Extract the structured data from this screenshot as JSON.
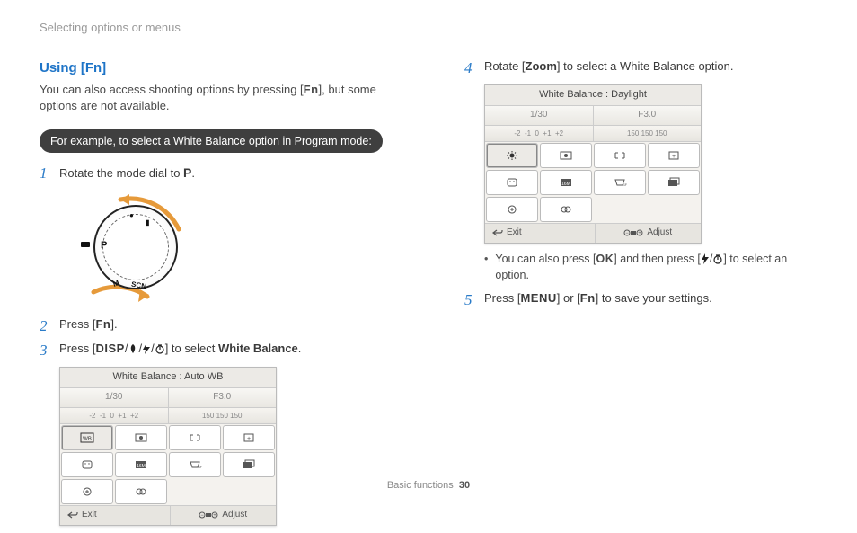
{
  "header": {
    "breadcrumb": "Selecting options or menus"
  },
  "section": {
    "title": "Using [Fn]",
    "intro_a": "You can also access shooting options by pressing [",
    "intro_fn": "Fn",
    "intro_b": "], but some options are not available.",
    "pill": "For example, to select a White Balance option in Program mode:"
  },
  "steps_left": [
    {
      "n": "1",
      "prefix": "Rotate the mode dial to ",
      "glyph": "P",
      "suffix": "."
    },
    {
      "n": "2",
      "prefix": "Press [",
      "glyph": "Fn",
      "suffix": "]."
    },
    {
      "n": "3",
      "prefix": "Press [",
      "glyph": "DISP",
      "mid": "/",
      "suffix": "] to select ",
      "bold": "White Balance",
      "end": "."
    }
  ],
  "steps_right": [
    {
      "n": "4",
      "prefix": "Rotate [",
      "glyph": "Zoom",
      "suffix": "] to select a White Balance option."
    },
    {
      "n": "5",
      "prefix": "Press [",
      "glyph": "MENU",
      "mid": "] or [",
      "glyph2": "Fn",
      "suffix": "] to save your settings."
    }
  ],
  "bullet_right": {
    "a": "You can also press [",
    "ok": "OK",
    "b": "] and then press [",
    "c": "] to select an option."
  },
  "panel_left": {
    "title": "White Balance : Auto WB",
    "shutter": "1/30",
    "aperture": "F3.0",
    "ev": "0",
    "iso_lo": "150",
    "iso_mid": "150",
    "iso_hi": "150",
    "exit": "Exit",
    "adjust": "Adjust"
  },
  "panel_right": {
    "title": "White Balance : Daylight",
    "shutter": "1/30",
    "aperture": "F3.0",
    "ev": "0",
    "iso_lo": "150",
    "iso_mid": "150",
    "iso_hi": "150",
    "exit": "Exit",
    "adjust": "Adjust"
  },
  "footer": {
    "section": "Basic functions",
    "page": "30"
  }
}
